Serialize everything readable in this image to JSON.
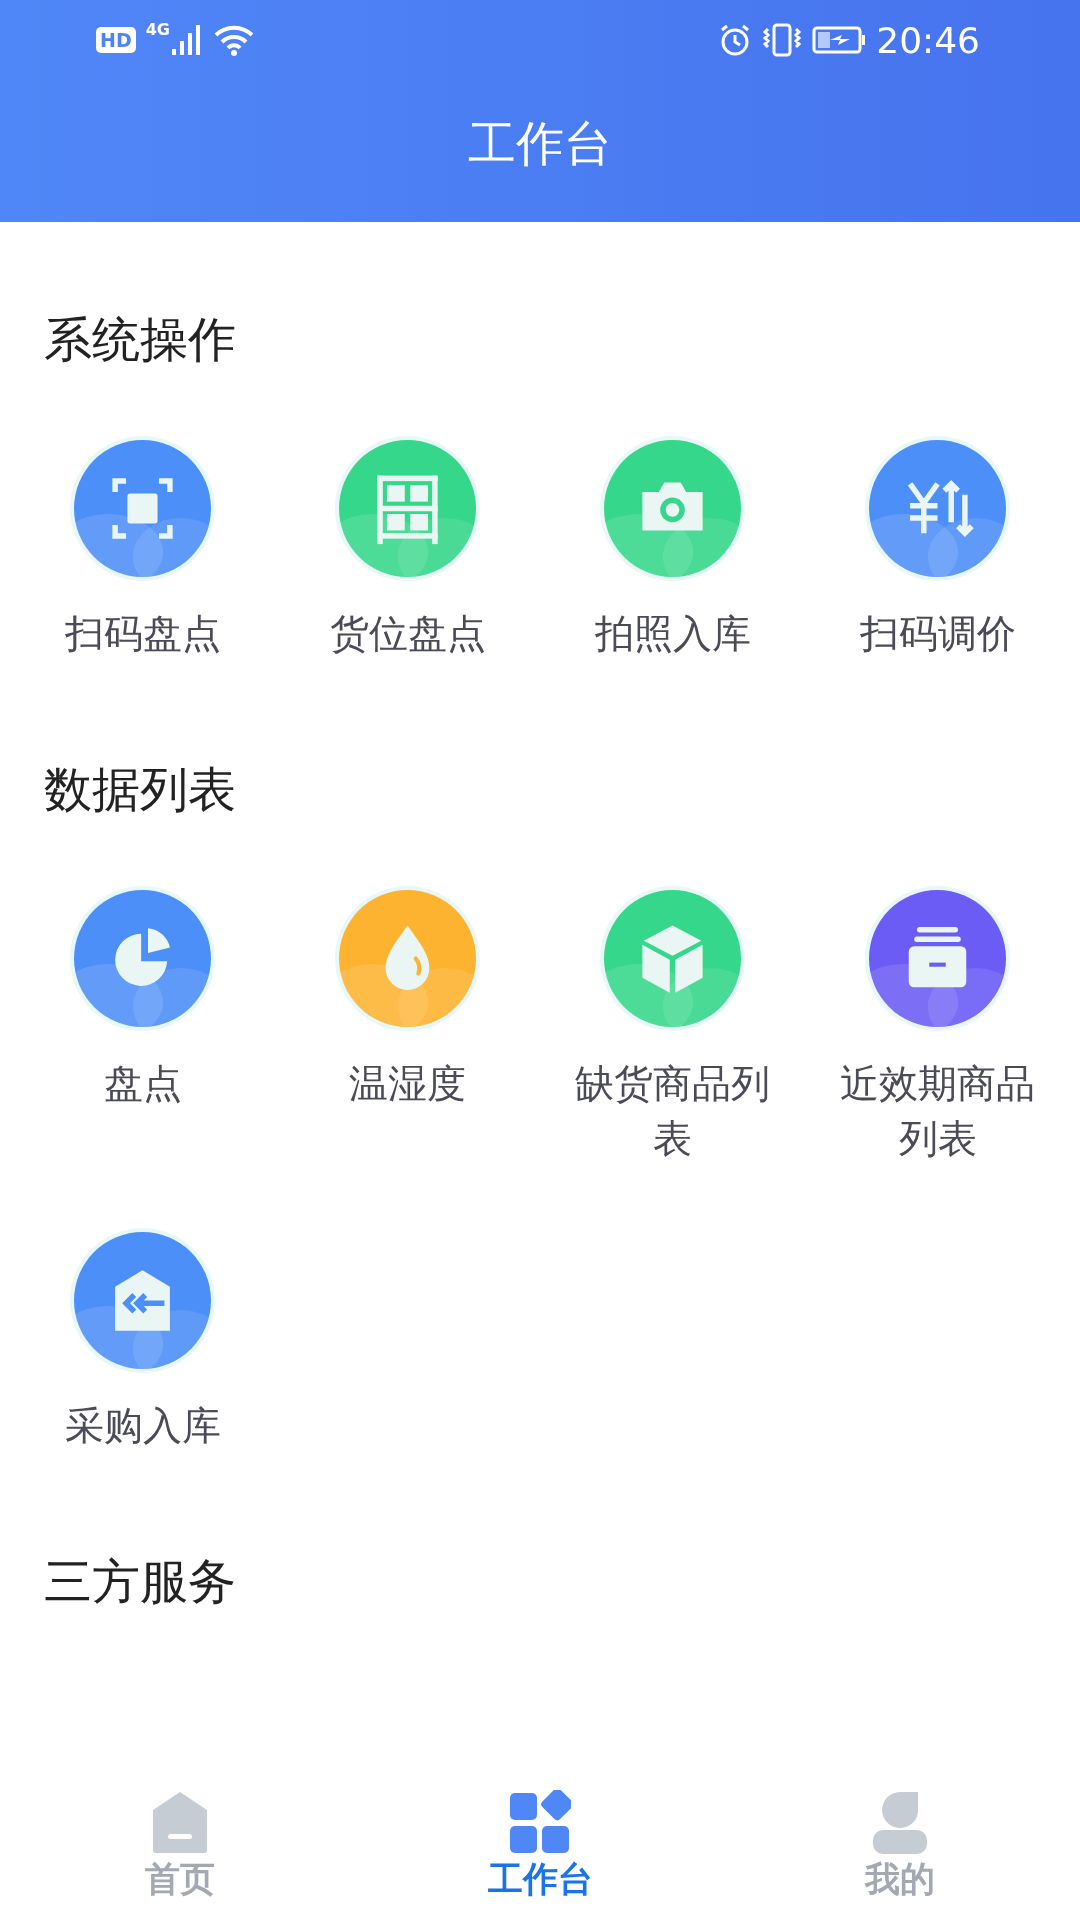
{
  "status_bar": {
    "hd": "HD",
    "network": "4G",
    "time": "20:46"
  },
  "header": {
    "title": "工作台"
  },
  "sections": [
    {
      "title": "系统操作",
      "items": [
        {
          "label": "扫码盘点",
          "kind": "scan",
          "color": "#4d8ff8"
        },
        {
          "label": "货位盘点",
          "kind": "shelf",
          "color": "#35d78a"
        },
        {
          "label": "拍照入库",
          "kind": "camera",
          "color": "#35d78a"
        },
        {
          "label": "扫码调价",
          "kind": "price",
          "color": "#4d8ff8"
        }
      ]
    },
    {
      "title": "数据列表",
      "items": [
        {
          "label": "盘点",
          "kind": "pie",
          "color": "#4d8ff8"
        },
        {
          "label": "温湿度",
          "kind": "drop",
          "color": "#fdb32f"
        },
        {
          "label": "缺货商品列表",
          "kind": "box",
          "color": "#35d78a"
        },
        {
          "label": "近效期商品列表",
          "kind": "archive",
          "color": "#6a5cf5"
        },
        {
          "label": "采购入库",
          "kind": "inbound",
          "color": "#4d8ff8"
        }
      ]
    },
    {
      "title": "三方服务"
    }
  ],
  "tabs": [
    {
      "label": "首页",
      "kind": "home",
      "selected": false
    },
    {
      "label": "工作台",
      "kind": "grid",
      "selected": true
    },
    {
      "label": "我的",
      "kind": "user",
      "selected": false
    }
  ]
}
